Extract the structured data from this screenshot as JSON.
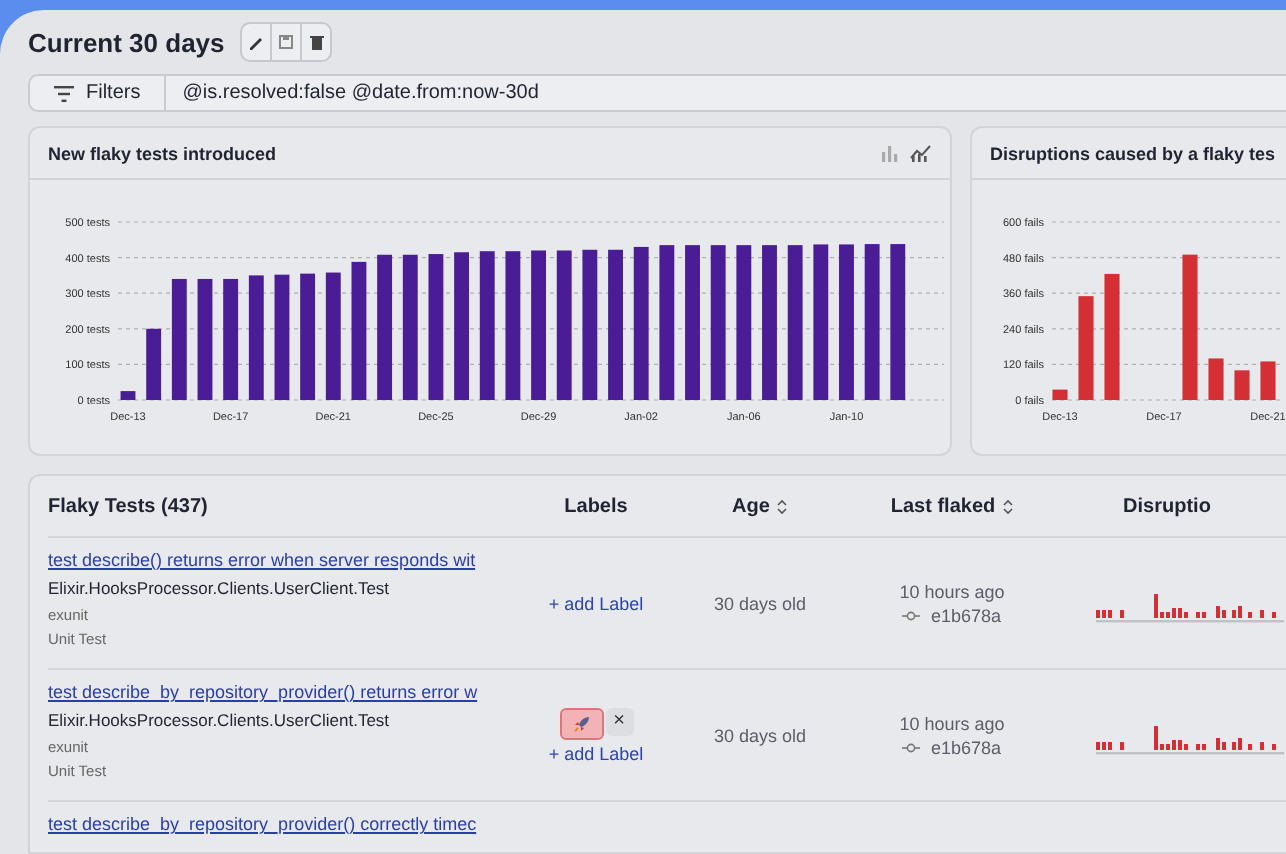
{
  "header": {
    "title": "Current 30 days"
  },
  "filter_bar": {
    "button": "Filters",
    "query": "@is.resolved:false @date.from:now-30d"
  },
  "charts": [
    {
      "title": "New flaky tests introduced",
      "view_switch": true,
      "chart_data": {
        "type": "bar",
        "grid": true,
        "categories": [
          "Dec-13",
          null,
          null,
          null,
          "Dec-17",
          null,
          null,
          null,
          "Dec-21",
          null,
          null,
          null,
          "Dec-25",
          null,
          null,
          null,
          "Dec-29",
          null,
          null,
          null,
          "Jan-02",
          null,
          null,
          null,
          "Jan-06",
          null,
          null,
          null,
          "Jan-10",
          null,
          null
        ],
        "series": [
          {
            "color": "#4a1d96",
            "values": [
              25,
              200,
              340,
              340,
              340,
              350,
              352,
              355,
              358,
              388,
              408,
              408,
              410,
              415,
              418,
              418,
              420,
              420,
              422,
              422,
              430,
              435,
              435,
              435,
              435,
              435,
              435,
              437,
              437,
              438,
              438
            ]
          }
        ],
        "ylim": [
          0,
          500
        ],
        "yticks": [
          {
            "value": 0,
            "label": "0 tests"
          },
          {
            "value": 100,
            "label": "100 tests"
          },
          {
            "value": 200,
            "label": "200 tests"
          },
          {
            "value": 300,
            "label": "300 tests"
          },
          {
            "value": 400,
            "label": "400 tests"
          },
          {
            "value": 500,
            "label": "500 tests"
          }
        ]
      }
    },
    {
      "title": "Disruptions caused by a flaky tes",
      "view_switch": false,
      "chart_data": {
        "type": "bar",
        "grid": true,
        "categories": [
          "Dec-13",
          null,
          null,
          null,
          "Dec-17",
          null,
          null,
          null,
          "Dec-21"
        ],
        "series": [
          {
            "color": "#d42f34",
            "values": [
              35,
              350,
              425,
              0,
              0,
              490,
              140,
              100,
              130
            ]
          }
        ],
        "ylim": [
          0,
          600
        ],
        "yticks": [
          {
            "value": 0,
            "label": "0 fails"
          },
          {
            "value": 120,
            "label": "120 fails"
          },
          {
            "value": 240,
            "label": "240 fails"
          },
          {
            "value": 360,
            "label": "360 fails"
          },
          {
            "value": 480,
            "label": "480 fails"
          },
          {
            "value": 600,
            "label": "600 fails"
          }
        ]
      }
    }
  ],
  "table": {
    "columns": [
      {
        "label": "Flaky Tests (437)",
        "sortable": false
      },
      {
        "label": "Labels",
        "sortable": false
      },
      {
        "label": "Age",
        "sortable": true
      },
      {
        "label": "Last flaked",
        "sortable": true
      },
      {
        "label": "Disruptio",
        "sortable": false
      }
    ],
    "rows": [
      {
        "title": "test describe() returns error when server responds wit",
        "module": "Elixir.HooksProcessor.Clients.UserClient.Test",
        "framework": "exunit",
        "type": "Unit Test",
        "labels": [],
        "add_label": "+ add Label",
        "age": "30 days old",
        "last_flaked": "10 hours ago",
        "commit": "e1b678a"
      },
      {
        "title": "test describe_by_repository_provider() returns error w",
        "module": "Elixir.HooksProcessor.Clients.UserClient.Test",
        "framework": "exunit",
        "type": "Unit Test",
        "labels": [
          {
            "color": "#f2b3b7",
            "remove": "×"
          }
        ],
        "add_label": "+ add Label",
        "age": "30 days old",
        "last_flaked": "10 hours ago",
        "commit": "e1b678a"
      },
      {
        "title": "test describe_by_repository_provider() correctly timec"
      }
    ]
  }
}
